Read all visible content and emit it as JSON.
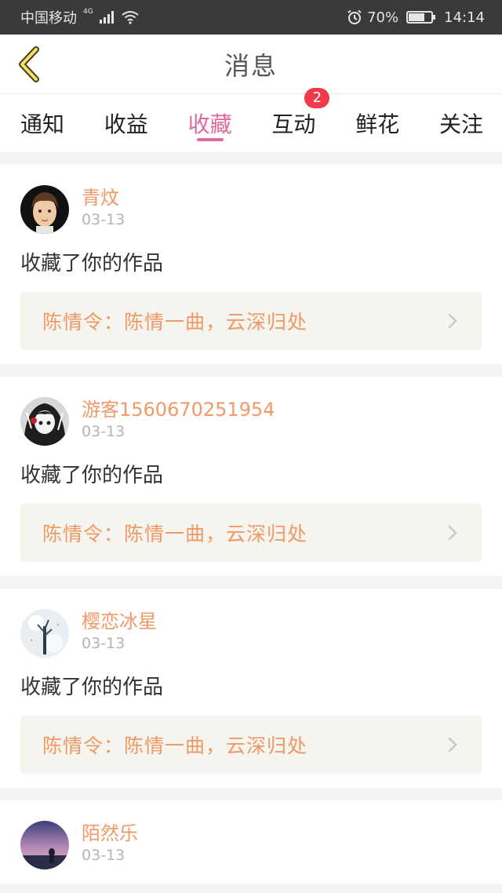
{
  "status_bar": {
    "carrier": "中国移动",
    "network": "4G",
    "battery": "70%",
    "battery_level": 0.7,
    "time": "14:14"
  },
  "header": {
    "title": "消息"
  },
  "tabs": [
    {
      "label": "通知",
      "active": false
    },
    {
      "label": "收益",
      "active": false
    },
    {
      "label": "收藏",
      "active": true
    },
    {
      "label": "互动",
      "active": false,
      "badge": "2"
    },
    {
      "label": "鲜花",
      "active": false
    },
    {
      "label": "关注",
      "active": false
    }
  ],
  "colors": {
    "accent": "#e06aa4",
    "username": "#f19a68",
    "badge": "#ef3b4a"
  },
  "messages": [
    {
      "user": "青炆",
      "date": "03-13",
      "action": "收藏了你的作品",
      "work": "陈情令：陈情一曲，云深归处",
      "avatar": "portrait-male-cartoon"
    },
    {
      "user": "游客1560670251954",
      "date": "03-13",
      "action": "收藏了你的作品",
      "work": "陈情令：陈情一曲，云深归处",
      "avatar": "monochrome-anime-girl"
    },
    {
      "user": "樱恋冰星",
      "date": "03-13",
      "action": "收藏了你的作品",
      "work": "陈情令：陈情一曲，云深归处",
      "avatar": "snowy-tree"
    },
    {
      "user": "陌然乐",
      "date": "03-13",
      "action": "",
      "work": "",
      "avatar": "sunset-silhouette"
    }
  ]
}
